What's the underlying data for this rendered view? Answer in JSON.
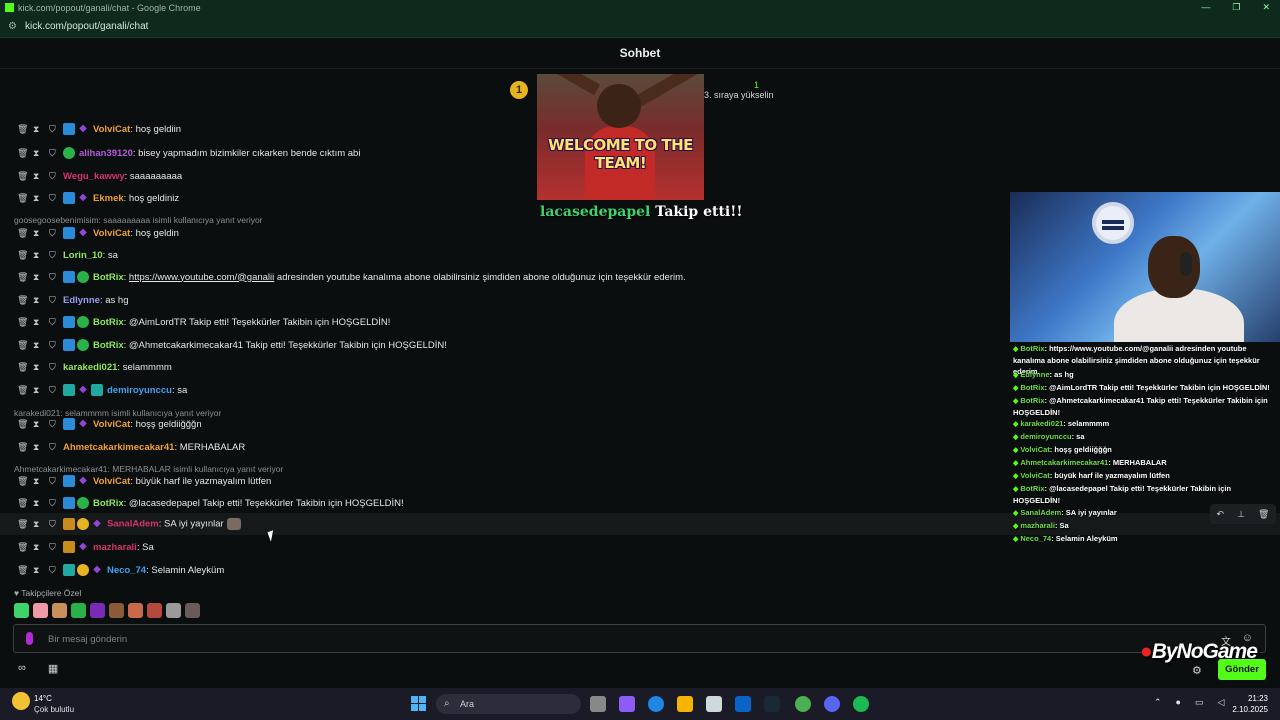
{
  "window": {
    "title": "kick.com/popout/ganali/chat - Google Chrome",
    "url": "kick.com/popout/ganali/chat",
    "controls": [
      "—",
      "❐",
      "✕"
    ]
  },
  "chat": {
    "header": "Sohbet",
    "pinned": {
      "rank_badge": "1",
      "right_number": "1",
      "right_text": "3. sıraya yükselin"
    },
    "alert": {
      "gif_text": "WELCOME TO THE TEAM!",
      "follower": "lacasedepapel",
      "suffix": "Takip etti!!"
    },
    "messages": [
      {
        "user": "VolviCat",
        "color": "#f0a030",
        "badges": [
          "blue",
          "purple"
        ],
        "text": "hoş geldiin"
      },
      {
        "user": "alihan39120",
        "color": "#b45ad8",
        "badges": [
          "green"
        ],
        "text": "bisey yapmadım bizimkiler cıkarken bende cıktım abi"
      },
      {
        "user": "Wegu_kawwy",
        "color": "#d6336c",
        "badges": [],
        "text": "saaaaaaaaa"
      },
      {
        "user": "Ekmek",
        "color": "#f0a030",
        "badges": [
          "blue",
          "purple"
        ],
        "text": "hoş geldiniz"
      },
      {
        "reply": "goosegoosebenimisim: saaaaaaaaa isimli kullanıcıya yanıt veriyor"
      },
      {
        "user": "VolviCat",
        "color": "#f0a030",
        "badges": [
          "blue",
          "purple"
        ],
        "text": "hoş geldin"
      },
      {
        "user": "Lorin_10",
        "color": "#8fe85a",
        "badges": [],
        "text": "sa"
      },
      {
        "user": "BotRix",
        "color": "#8fe85a",
        "badges": [
          "blue",
          "green"
        ],
        "text": "",
        "link": "https://www.youtube.com/@ganalii",
        "after_link": " adresinden youtube kanalıma abone olabilirsiniz şimdiden abone olduğunuz için teşekkür ederim."
      },
      {
        "user": "Edlynne",
        "color": "#9a9cf0",
        "badges": [],
        "text": "as hg"
      },
      {
        "user": "BotRix",
        "color": "#8fe85a",
        "badges": [
          "blue",
          "green"
        ],
        "text": "@AimLordTR Takip etti! Teşekkürler Takibin için HOŞGELDİN!"
      },
      {
        "user": "BotRix",
        "color": "#8fe85a",
        "badges": [
          "blue",
          "green"
        ],
        "text": "@Ahmetcakarkimecakar41 Takip etti! Teşekkürler Takibin için HOŞGELDİN!"
      },
      {
        "user": "karakedi021",
        "color": "#8fe85a",
        "badges": [],
        "text": "selammmm"
      },
      {
        "user": "demiroyunccu",
        "color": "#3fa0f0",
        "badges": [
          "teal",
          "purple",
          "teal"
        ],
        "text": "sa"
      },
      {
        "reply": "karakedi021: selammmm isimli kullanıcıya yanıt veriyor"
      },
      {
        "user": "VolviCat",
        "color": "#f0a030",
        "badges": [
          "blue",
          "purple"
        ],
        "text": "hoşş geldiiğğğn"
      },
      {
        "user": "Ahmetcakarkimecakar41",
        "color": "#f0a030",
        "badges": [],
        "text": "MERHABALAR"
      },
      {
        "reply": "Ahmetcakarkimecakar41: MERHABALAR isimli kullanıcıya yanıt veriyor"
      },
      {
        "user": "VolviCat",
        "color": "#f0a030",
        "badges": [
          "blue",
          "purple"
        ],
        "text": "büyük harf ile yazmayalım lütfen"
      },
      {
        "user": "BotRix",
        "color": "#8fe85a",
        "badges": [
          "blue",
          "green"
        ],
        "text": "@lacasedepapel Takip etti! Teşekkürler Takibin için HOŞGELDİN!"
      },
      {
        "user": "SanalAdem",
        "color": "#d6336c",
        "badges": [
          "orange",
          "gold",
          "purple"
        ],
        "text": "SA iyi yayınlar",
        "emote": true,
        "highlight": true
      },
      {
        "user": "mazharali",
        "color": "#d6336c",
        "badges": [
          "orange",
          "purple"
        ],
        "text": "Sa"
      },
      {
        "user": "Neco_74",
        "color": "#3fa0f0",
        "badges": [
          "teal",
          "gold",
          "purple"
        ],
        "text": "Selamin Aleyküm"
      }
    ],
    "follower_only": "Takipçilere Özel",
    "emotes": [
      "#3fd36b",
      "#f09aa8",
      "#c8905a",
      "#2bb14a",
      "#7a2ab8",
      "#8a5a3a",
      "#c86a4a",
      "#b44a3a",
      "#9a9a9a",
      "#6a5a5a"
    ],
    "input_placeholder": "Bir mesaj gönderin",
    "send_label": "Gönder",
    "accent": "#53fc18"
  },
  "stream": {
    "overlay_logo": "ByNoGame",
    "mini_chat": [
      {
        "user": "BotRix",
        "text": ": https://www.youtube.com/@ganalii adresinden youtube kanalıma abone olabilirsiniz şimdiden abone olduğunuz için teşekkür ederim."
      },
      {
        "user": "Edlynne",
        "text": ": as hg"
      },
      {
        "user": "BotRix",
        "text": ": @AimLordTR Takip etti! Teşekkürler Takibin için HOŞGELDİN!"
      },
      {
        "user": "BotRix",
        "text": ": @Ahmetcakarkimecakar41 Takip etti! Teşekkürler Takibin için HOŞGELDİN!"
      },
      {
        "user": "karakedi021",
        "text": ": selammmm"
      },
      {
        "user": "demiroyunccu",
        "text": ": sa"
      },
      {
        "user": "VolviCat",
        "text": ": hoşş geldiiğğğn"
      },
      {
        "user": "Ahmetcakarkimecakar41",
        "text": ": MERHABALAR"
      },
      {
        "user": "VolviCat",
        "text": ": büyük harf ile yazmayalım lütfen"
      },
      {
        "user": "BotRix",
        "text": ": @lacasedepapel Takip etti! Teşekkürler Takibin için HOŞGELDİN!"
      },
      {
        "user": "SanalAdem",
        "text": ": SA iyi yayınlar"
      },
      {
        "user": "mazharali",
        "text": ": Sa"
      },
      {
        "user": "Neco_74",
        "text": ": Selamin Aleyküm"
      }
    ]
  },
  "taskbar": {
    "weather_temp": "14°C",
    "weather_desc": "Çok bulutlu",
    "search_placeholder": "Ara",
    "time": "21:23",
    "date": "2.10.2025"
  }
}
